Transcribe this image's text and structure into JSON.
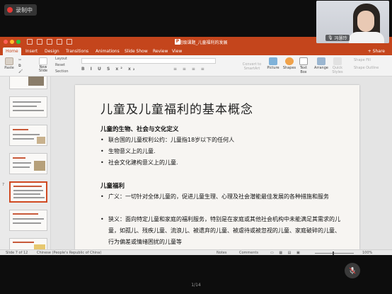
{
  "recording": {
    "label": "录制中"
  },
  "window": {
    "title": "班级课题_儿童福利的发展",
    "app_icon": "P"
  },
  "ribbon_tabs": [
    "Home",
    "Insert",
    "Design",
    "Transitions",
    "Animations",
    "Slide Show",
    "Review",
    "View"
  ],
  "share_label": "Share",
  "ribbon": {
    "paste": "Paste",
    "new_slide": "New\nSlide",
    "layout": "Layout",
    "reset": "Reset",
    "section": "Section",
    "convert": "Convert to SmartArt",
    "picture": "Picture",
    "shapes": "Shapes",
    "text_box": "Text Box",
    "arrange": "Arrange",
    "quick_styles": "Quick Styles",
    "shape_fill": "Shape Fill",
    "shape_outline": "Shape Outline"
  },
  "thumbnails": [
    {
      "num": ""
    },
    {
      "num": ""
    },
    {
      "num": ""
    },
    {
      "num": ""
    },
    {
      "num": "7"
    },
    {
      "num": ""
    },
    {
      "num": ""
    }
  ],
  "slide": {
    "title": "儿童及儿童福利的基本概念",
    "section1": "儿童的生物、社会与文化定义",
    "bullets1": [
      "联合国的儿童权利公约：儿童指18岁以下的任何人",
      "生物意义上的儿童.",
      "社会文化建构意义上的儿童."
    ],
    "section2": "儿童福利",
    "bullets2": [
      "广义：一切针对全体儿童的，促进儿童生理、心理及社会潜能最佳发展的各种措施和服务",
      "狭义：面向特定儿童和家庭的福利服务，特别是在家庭或其他社会机构中未能满足其需求的儿童，如孤儿、残疾儿童、流浪儿、被遗弃的儿童、被虐待或被忽视的儿童、家庭破碎的儿童、行为偏差或情绪困扰的儿童等"
    ],
    "bullet_glyph": "•"
  },
  "status": {
    "slide_of": "Slide 7 of 12",
    "language": "Chinese (People's Republic of China)",
    "notes": "Notes",
    "comments": "Comments",
    "zoom": "100%"
  },
  "webcam": {
    "name": "冯慧玲"
  },
  "pager": "1/14",
  "colors": {
    "accent": "#c4451c",
    "recording": "#e53935"
  }
}
